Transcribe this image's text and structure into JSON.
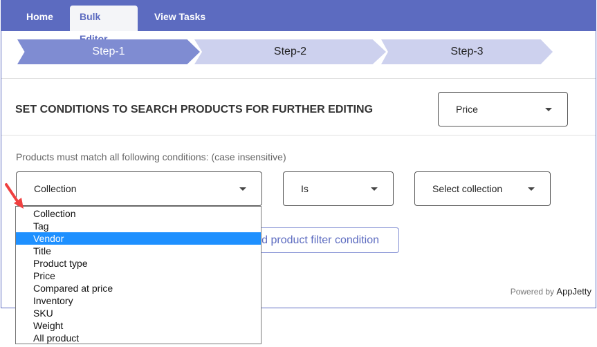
{
  "nav": {
    "tabs": [
      {
        "label": "Home"
      },
      {
        "label": "Bulk Editor",
        "active": true
      },
      {
        "label": "View Tasks"
      }
    ]
  },
  "steps": [
    {
      "label": "Step-1",
      "active": true
    },
    {
      "label": "Step-2"
    },
    {
      "label": "Step-3"
    }
  ],
  "section": {
    "title": "SET CONDITIONS TO SEARCH PRODUCTS FOR FURTHER EDITING",
    "field_select": "Price"
  },
  "conditions": {
    "label": "Products must match all following conditions: (case insensitive)",
    "field": "Collection",
    "operator": "Is",
    "value": "Select collection",
    "add_button": "Add product filter condition"
  },
  "dropdown": {
    "options": [
      "Collection",
      "Tag",
      "Vendor",
      "Title",
      "Product type",
      "Price",
      "Compared at price",
      "Inventory",
      "SKU",
      "Weight",
      "All product"
    ],
    "highlighted": "Vendor"
  },
  "footer": {
    "powered_by": "Powered by",
    "brand": "AppJetty"
  },
  "colors": {
    "header": "#5c6bc0",
    "step_active": "#7f8cd2",
    "step_inactive": "#cdd1ee",
    "highlight": "#1e90ff",
    "annotation_arrow": "#f04040"
  }
}
